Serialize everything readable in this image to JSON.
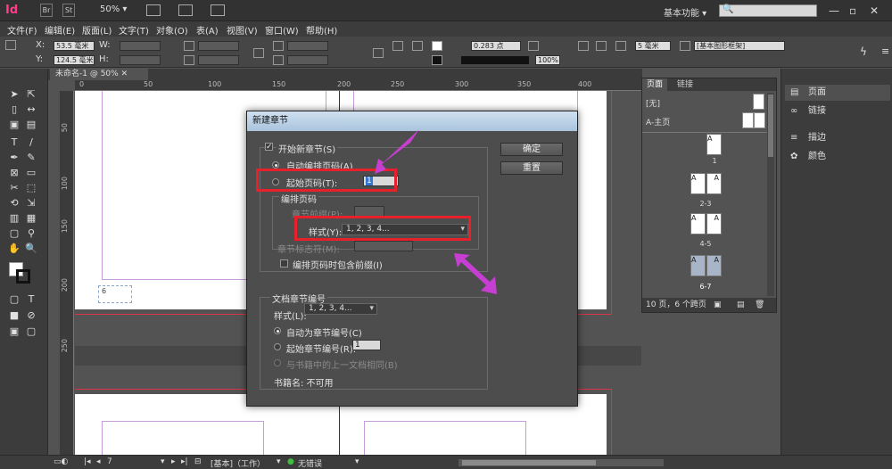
{
  "titlebar": {
    "app_logo": "Id",
    "box1": "Br",
    "box2": "St",
    "zoom": "50%",
    "workspace": "基本功能",
    "search_placeholder": "🔍"
  },
  "menus": [
    "文件(F)",
    "编辑(E)",
    "版面(L)",
    "文字(T)",
    "对象(O)",
    "表(A)",
    "视图(V)",
    "窗口(W)",
    "帮助(H)"
  ],
  "controlbar": {
    "x_label": "X:",
    "x_value": "53.5 毫米",
    "y_label": "Y:",
    "y_value": "124.5 毫米",
    "w_label": "W:",
    "h_label": "H:",
    "stroke_weight": "0.283 点",
    "opacity": "100%",
    "size": "5 毫米",
    "style_select": "[基本图形框架]"
  },
  "document": {
    "tab_title": "未命名-1 @ 50%",
    "page_number_label": "6"
  },
  "ruler": {
    "h_labels": [
      "0",
      "50",
      "100",
      "150",
      "200",
      "250",
      "300",
      "350",
      "400"
    ],
    "v_labels": [
      "50",
      "100",
      "150",
      "200",
      "250"
    ]
  },
  "pages_panel": {
    "tab_pages": "页面",
    "tab_links": "链接",
    "master_none": "[无]",
    "master_a": "A-主页",
    "spreads": [
      {
        "label": "1",
        "pages": [
          "A"
        ]
      },
      {
        "label": "2-3",
        "pages": [
          "A",
          "A"
        ]
      },
      {
        "label": "4-5",
        "pages": [
          "A",
          "A"
        ]
      },
      {
        "label": "6-7",
        "pages": [
          "A",
          "A"
        ]
      }
    ],
    "status": "10 页，6 个跨页"
  },
  "right_dock": {
    "items": [
      {
        "label": "页面",
        "icon": "pages-icon"
      },
      {
        "label": "链接",
        "icon": "links-icon"
      },
      {
        "label": "描边",
        "icon": "stroke-icon"
      },
      {
        "label": "颜色",
        "icon": "color-icon"
      }
    ]
  },
  "dialog": {
    "title": "新建章节",
    "start_section_label": "开始新章节(S)",
    "auto_numbering_label": "自动编排页码(A)",
    "start_page_label": "起始页码(T):",
    "start_page_value": "1",
    "page_numbering_group": "编排页码",
    "section_prefix_label": "章节前缀(P):",
    "style_label": "样式(Y):",
    "style_value": "1, 2, 3, 4...",
    "section_marker_label": "章节标志符(M):",
    "include_prefix_label": "编排页码时包含前缀(I)",
    "doc_chapter_group": "文档章节编号",
    "chapter_style_label": "样式(L):",
    "chapter_style_value": "1, 2, 3, 4...",
    "auto_chapter_label": "自动为章节编号(C)",
    "start_chapter_label": "起始章节编号(R):",
    "start_chapter_value": "1",
    "same_as_prev_label": "与书籍中的上一文档相同(B)",
    "book_name_label": "书籍名: 不可用",
    "ok_button": "确定",
    "reset_button": "重置"
  },
  "statusbar": {
    "page_value": "7",
    "master_label": "[基本]（工作）",
    "preflight": "无错误"
  },
  "colors": {
    "accent_annotation": "#e8202c",
    "arrow": "#c63fd2",
    "app_logo": "#ff3d8b"
  }
}
